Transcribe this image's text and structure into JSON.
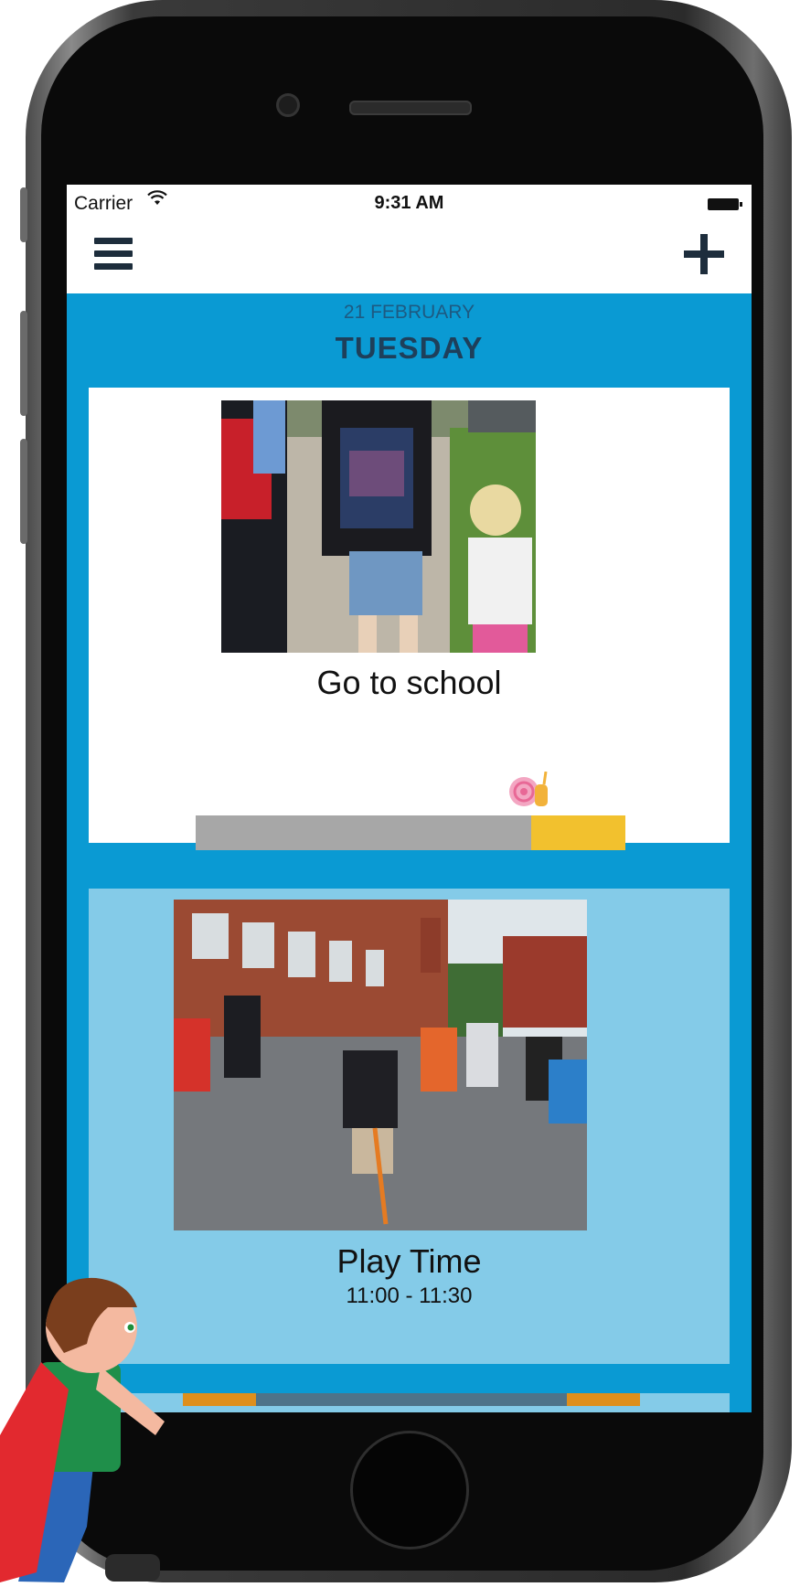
{
  "status_bar": {
    "carrier": "Carrier",
    "time": "9:31 AM"
  },
  "header": {
    "date": "21 FEBRUARY",
    "day": "TUESDAY"
  },
  "activities": [
    {
      "title": "Go to school",
      "time": "",
      "progress": 0.78
    },
    {
      "title": "Play Time",
      "time": "11:00 - 11:30"
    }
  ],
  "icons": {
    "menu": "hamburger-menu-icon",
    "add": "plus-icon",
    "wifi": "wifi-icon",
    "battery": "battery-icon",
    "progress_marker": "snail-icon"
  },
  "colors": {
    "screen_bg": "#0a9ad3",
    "card_active_bg": "#ffffff",
    "card_upcoming_bg": "#84cbe8",
    "progress_elapsed": "#a7a7a7",
    "progress_remaining": "#f2c12e",
    "day_text": "#1e3f5a"
  }
}
